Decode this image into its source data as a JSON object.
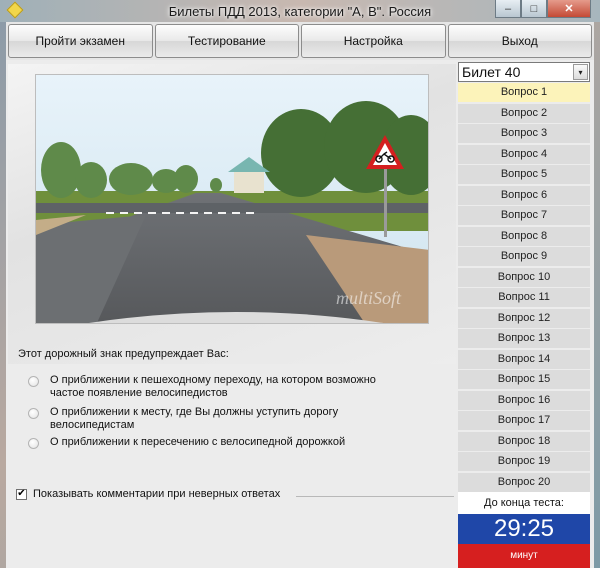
{
  "window": {
    "title": "Билеты ПДД 2013, категории \"A, B\". Россия",
    "minimize_glyph": "–",
    "maximize_glyph": "□",
    "close_glyph": "✕"
  },
  "menu": [
    "Пройти экзамен",
    "Тестирование",
    "Настройка",
    "Выход"
  ],
  "picture": {
    "watermark": "multiSoft"
  },
  "question": {
    "text": "Этот дорожный знак предупреждает Вас:",
    "answers": [
      {
        "line1": "О приближении к пешеходному переходу, на котором возможно",
        "line2": "частое появление велосипедистов"
      },
      {
        "line1": "О приближении к месту, где Вы должны уступить дорогу",
        "line2": "велосипедистам"
      },
      {
        "line1": "О приближении к пересечению с велосипедной дорожкой",
        "line2": ""
      }
    ]
  },
  "comments": {
    "checked_glyph": "✔",
    "label": "Показывать комментарии при неверных ответах"
  },
  "ticket": {
    "selected": "Билет 40",
    "arrow_glyph": "▾"
  },
  "questions_list": {
    "current_index": 0,
    "items": [
      "Вопрос 1",
      "Вопрос 2",
      "Вопрос 3",
      "Вопрос 4",
      "Вопрос 5",
      "Вопрос 6",
      "Вопрос 7",
      "Вопрос 8",
      "Вопрос 9",
      "Вопрос 10",
      "Вопрос 11",
      "Вопрос 12",
      "Вопрос 13",
      "Вопрос 14",
      "Вопрос 15",
      "Вопрос 16",
      "Вопрос 17",
      "Вопрос 18",
      "Вопрос 19",
      "Вопрос 20"
    ]
  },
  "timer": {
    "label": "До конца теста:",
    "time": "29:25",
    "unit": "минут"
  },
  "colors": {
    "current_question": "#fcf3ba",
    "timer_blue": "#1f47a8",
    "timer_red": "#d61f1f"
  }
}
